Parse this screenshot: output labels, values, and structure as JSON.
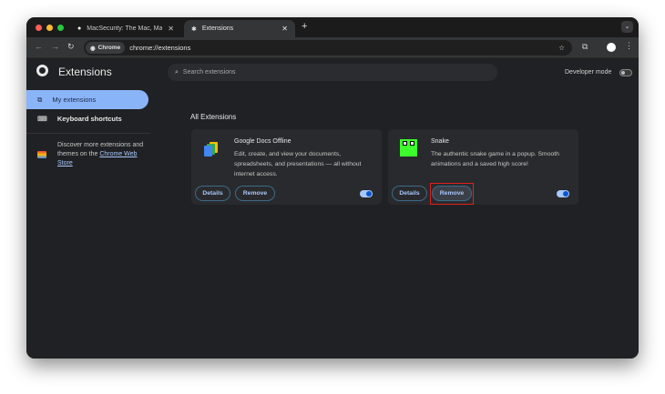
{
  "tabs": [
    {
      "title": "MacSecurity: The Mac, MacB",
      "icon": "apple-icon"
    },
    {
      "title": "Extensions",
      "icon": "puzzle-icon"
    }
  ],
  "toolbar": {
    "chip": "Chrome",
    "url": "chrome://extensions"
  },
  "header": {
    "title": "Extensions",
    "search_placeholder": "Search extensions",
    "dev_mode": "Developer mode",
    "dev_mode_on": false
  },
  "sidebar": {
    "items": [
      {
        "label": "My extensions",
        "active": true
      },
      {
        "label": "Keyboard shortcuts"
      }
    ],
    "discover_text": "Discover more extensions and themes on the ",
    "discover_link": "Chrome Web Store"
  },
  "main": {
    "section_title": "All Extensions",
    "extensions": [
      {
        "name": "Google Docs Offline",
        "description": "Edit, create, and view your documents, spreadsheets, and presentations — all without internet access.",
        "details": "Details",
        "remove": "Remove",
        "enabled": true
      },
      {
        "name": "Snake",
        "description": "The authentic snake game in a popup. Smooth animations and a saved high score!",
        "details": "Details",
        "remove": "Remove",
        "enabled": true
      }
    ]
  },
  "colors": {
    "accent": "#8ab4f8",
    "highlight": "#e0201b",
    "snake_green": "#3cff2b"
  }
}
